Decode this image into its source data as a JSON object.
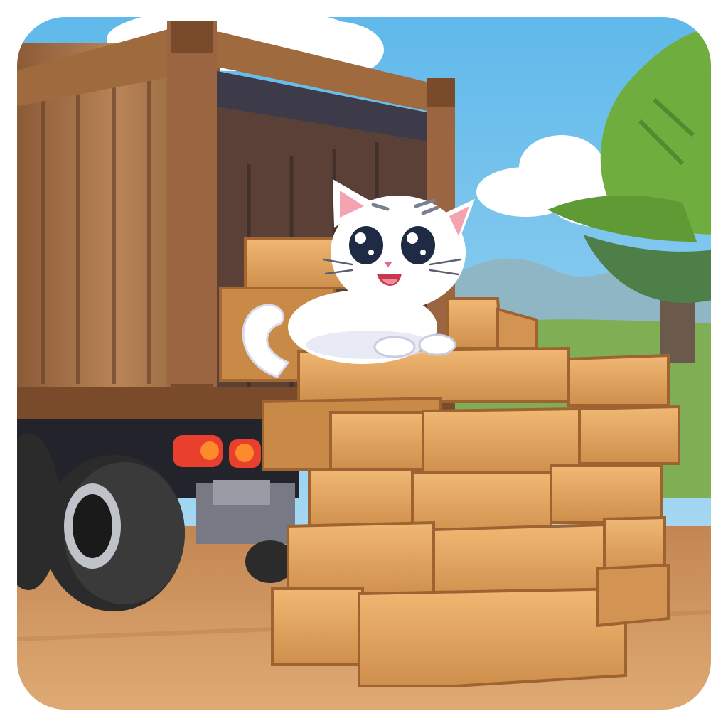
{
  "scene": {
    "subject": "cat",
    "colors": {
      "sky_top": "#5db8ea",
      "sky_bottom": "#bfe3f5",
      "cloud": "#ffffff",
      "hills": "#8fb6c5",
      "grass": "#6aa84f",
      "road": "#d49b63",
      "truck_wood": "#a9754a",
      "truck_dark": "#5b4037",
      "crate": "#e0a45e",
      "crate_dark": "#b9773f",
      "cat_fur": "#ffffff",
      "cat_shadow": "#d9dcef",
      "cat_eye": "#1f2a44",
      "cat_ear_inner": "#f4a3b1",
      "tree_leaf": "#6fae3e",
      "tree_trunk": "#6b5a4c",
      "tire": "#2b2b2b",
      "tail_light": "#e8402d"
    },
    "icons": [
      "cat-character",
      "truck-icon",
      "wooden-crate",
      "tree-icon"
    ]
  }
}
